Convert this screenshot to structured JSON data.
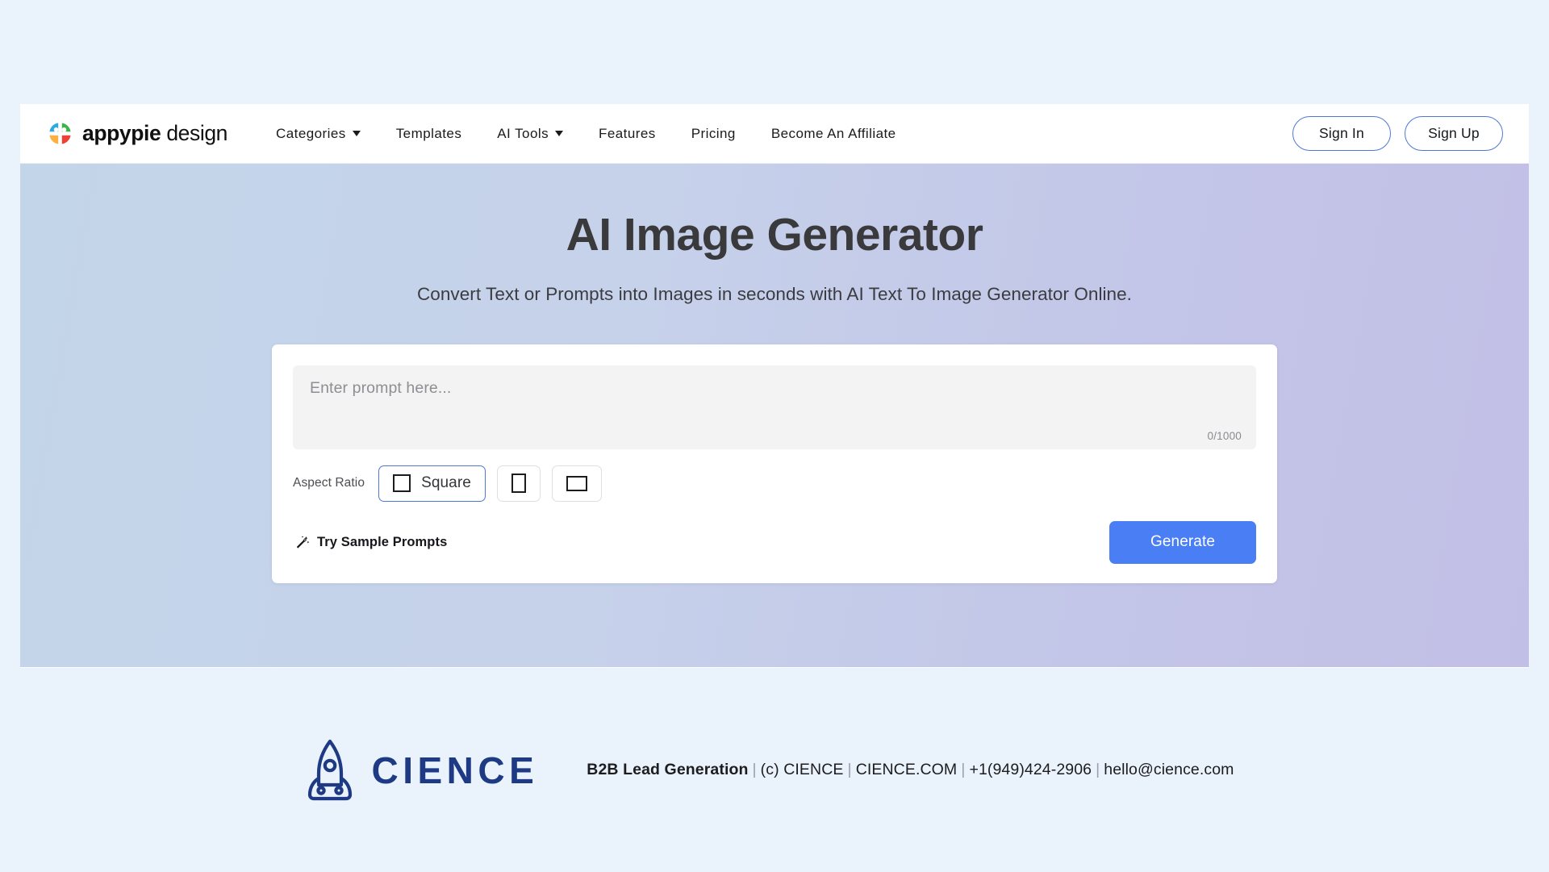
{
  "header": {
    "brand": {
      "bold": "appypie",
      "light": "design"
    },
    "nav": [
      {
        "label": "Categories",
        "has_caret": true
      },
      {
        "label": "Templates",
        "has_caret": false
      },
      {
        "label": "AI Tools",
        "has_caret": true
      },
      {
        "label": "Features",
        "has_caret": false
      },
      {
        "label": "Pricing",
        "has_caret": false
      },
      {
        "label": "Become An Affiliate",
        "has_caret": false
      }
    ],
    "sign_in": "Sign In",
    "sign_up": "Sign Up"
  },
  "hero": {
    "title": "AI Image Generator",
    "subtitle": "Convert Text or Prompts into Images in seconds with AI Text To Image Generator Online."
  },
  "prompt_card": {
    "placeholder": "Enter prompt here...",
    "char_count": "0/1000",
    "aspect_ratio_label": "Aspect Ratio",
    "aspect_ratios": [
      {
        "name": "Square",
        "shape": "square",
        "selected": true
      },
      {
        "name": "",
        "shape": "portrait",
        "selected": false
      },
      {
        "name": "",
        "shape": "landscape",
        "selected": false
      }
    ],
    "sample_prompts_label": "Try Sample Prompts",
    "generate_label": "Generate"
  },
  "footer": {
    "logo_word": "CIENCE",
    "tagline": "B2B Lead Generation",
    "copyright": "(c) CIENCE",
    "website": "CIENCE.COM",
    "phone": "+1(949)424-2906",
    "email": "hello@cience.com",
    "separator": "|"
  },
  "colors": {
    "accent_blue": "#4a7ef5",
    "outline_blue": "#4d79d6",
    "brand_navy": "#1e3a84",
    "page_bg": "#eaf2fb",
    "hero_gradient_start": "#c3d5e9",
    "hero_gradient_end": "#c2bfe6"
  }
}
